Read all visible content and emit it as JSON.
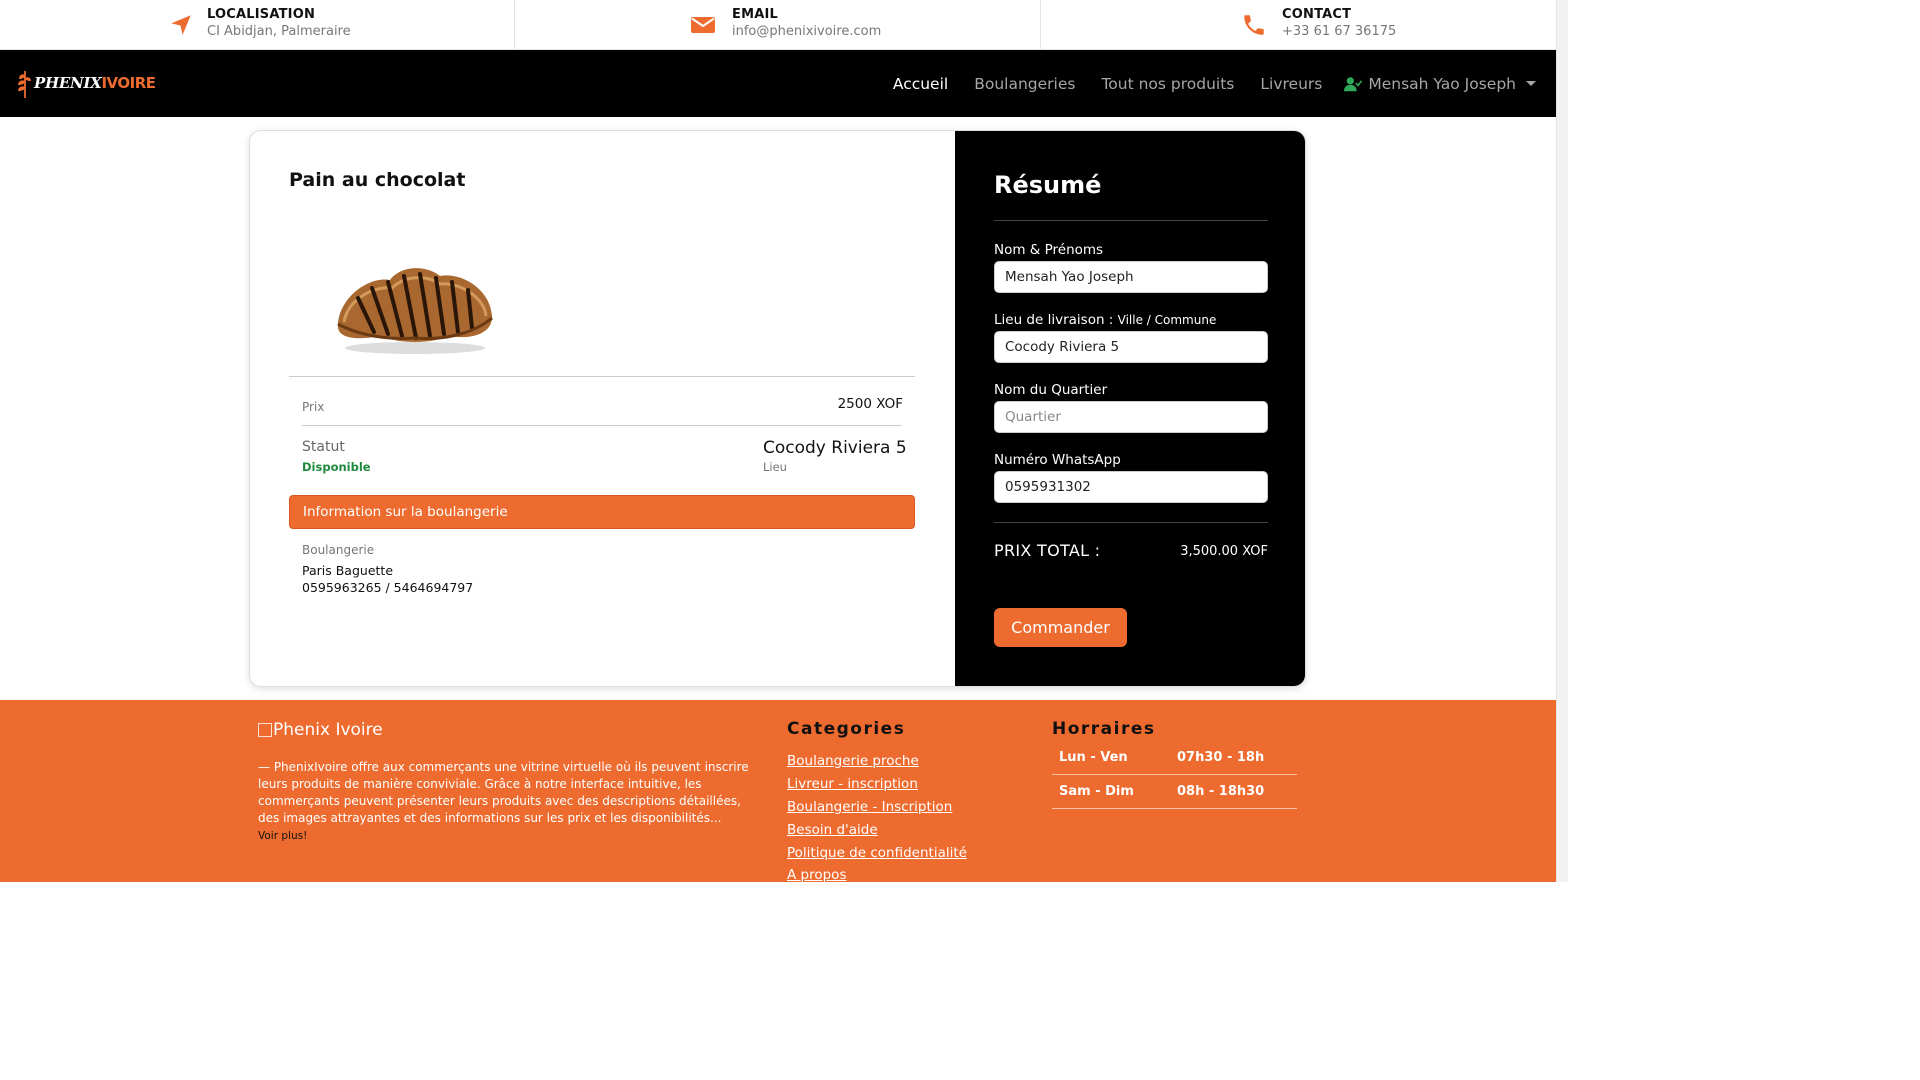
{
  "topbar": {
    "location": {
      "title": "LOCALISATION",
      "value": "CI Abidjan, Palmeraire",
      "icon": "location-arrow-icon"
    },
    "email": {
      "title": "EMAIL",
      "value": "info@phenixivoire.com",
      "icon": "envelope-icon"
    },
    "contact": {
      "title": "CONTACT",
      "value": "+33 61 67 36175",
      "icon": "phone-icon"
    }
  },
  "nav": {
    "brand_part1": "PHENIX",
    "brand_part2": "IVOIRE",
    "links": [
      "Accueil",
      "Boulangeries",
      "Tout nos produits",
      "Livreurs"
    ],
    "user": "Mensah Yao Joseph",
    "user_icon": "user-check-icon"
  },
  "product": {
    "title": "Pain au chocolat",
    "price_label": "Prix",
    "price_value": "2500 XOF",
    "status_label": "Statut",
    "status_value": "Disponible",
    "location_value": "Cocody Riviera 5",
    "location_label": "Lieu",
    "info_banner": "Information sur la boulangerie",
    "bakery_label": "Boulangerie",
    "bakery_name": "Paris Baguette",
    "bakery_phone": "0595963265 / 5464694797"
  },
  "summary": {
    "title": "Résumé",
    "name_label": "Nom & Prénoms",
    "name_value": "Mensah Yao Joseph",
    "delivery_label": "Lieu de livraison : ",
    "delivery_hint": "Ville / Commune",
    "delivery_value": "Cocody Riviera 5",
    "quarter_label": "Nom du Quartier",
    "quarter_placeholder": "Quartier",
    "whatsapp_label": "Numéro WhatsApp",
    "whatsapp_value": "0595931302",
    "total_label": "PRIX TOTAL :",
    "total_value": "3,500.00 XOF",
    "order_button": "Commander"
  },
  "footer": {
    "logo_alt": "Phenix Ivoire",
    "description": "— PhenixIvoire offre aux commerçants une vitrine virtuelle où ils peuvent inscrire leurs produits de manière conviviale. Grâce à notre interface intuitive, les commerçants peuvent présenter leurs produits avec des descriptions détaillées, des images attrayantes et des informations sur les prix et les disponibilités...",
    "more": "Voir plus!",
    "categories_title": "Categories",
    "categories": [
      "Boulangerie proche",
      "Livreur - inscription",
      "Boulangerie - Inscription",
      "Besoin d'aide",
      "Politique de confidentialité",
      "A propos"
    ],
    "hours_title": "Horraires",
    "hours": [
      {
        "days": "Lun - Ven",
        "time": "07h30 - 18h"
      },
      {
        "days": "Sam - Dim",
        "time": "08h - 18h30"
      }
    ]
  },
  "colors": {
    "accent": "#ee6b2f",
    "nav_bg": "#000000",
    "status_green": "#1f8a3e"
  }
}
